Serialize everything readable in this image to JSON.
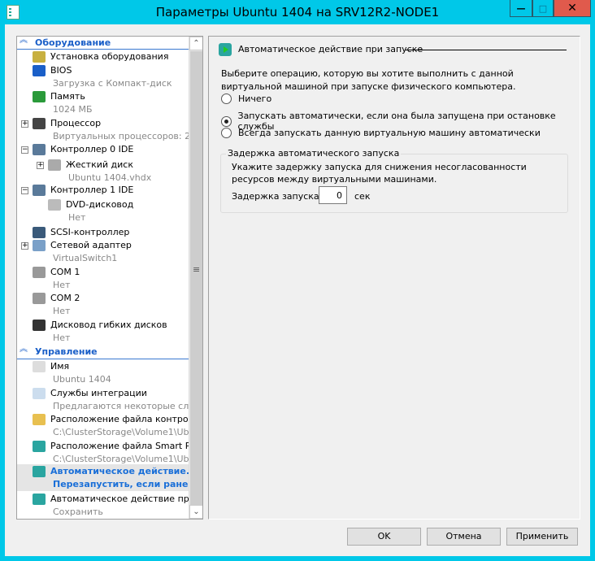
{
  "window": {
    "title": "Параметры Ubuntu 1404 на SRV12R2-NODE1",
    "minimize": "—",
    "maximize": "□",
    "close": "✕"
  },
  "tree": {
    "hardware_header": "Оборудование",
    "management_header": "Управление",
    "items": [
      {
        "label": "Установка оборудования",
        "icon": "add-hardware-icon",
        "color": "#c8b040"
      },
      {
        "label": "BIOS",
        "sub": "Загрузка с Компакт-диск",
        "icon": "bios-icon",
        "color": "#1a5fc8"
      },
      {
        "label": "Память",
        "sub": "1024 МБ",
        "icon": "memory-icon",
        "color": "#2a9a3a"
      },
      {
        "label": "Процессор",
        "sub": "Виртуальных процессоров: 2",
        "icon": "processor-icon",
        "color": "#444",
        "expander": "+"
      },
      {
        "label": "Контроллер 0 IDE",
        "icon": "ide-controller-icon",
        "color": "#5a7a9a",
        "expander": "−"
      },
      {
        "label": "Жесткий диск",
        "sub": "Ubuntu 1404.vhdx",
        "icon": "hard-disk-icon",
        "color": "#aaa",
        "expander": "+",
        "indent": true
      },
      {
        "label": "Контроллер 1 IDE",
        "icon": "ide-controller-icon",
        "color": "#5a7a9a",
        "expander": "−"
      },
      {
        "label": "DVD-дисковод",
        "sub": "Нет",
        "icon": "dvd-icon",
        "color": "#bbb",
        "indent": true
      },
      {
        "label": "SCSI-контроллер",
        "icon": "scsi-controller-icon",
        "color": "#3a5a7a"
      },
      {
        "label": "Сетевой адаптер",
        "sub": "VirtualSwitch1",
        "icon": "network-adapter-icon",
        "color": "#7aa0c8",
        "expander": "+"
      },
      {
        "label": "COM 1",
        "sub": "Нет",
        "icon": "com-port-icon",
        "color": "#999"
      },
      {
        "label": "COM 2",
        "sub": "Нет",
        "icon": "com-port-icon",
        "color": "#999"
      },
      {
        "label": "Дисковод гибких дисков",
        "sub": "Нет",
        "icon": "floppy-icon",
        "color": "#333"
      },
      {
        "label": "Имя",
        "sub": "Ubuntu 1404",
        "icon": "name-icon",
        "color": "#ddd"
      },
      {
        "label": "Службы интеграции",
        "sub": "Предлагаются некоторые сл...",
        "icon": "integration-services-icon",
        "color": "#cde"
      },
      {
        "label": "Расположение файла контрол...",
        "sub": "C:\\ClusterStorage\\Volume1\\Ub...",
        "icon": "checkpoint-folder-icon",
        "color": "#e8c050"
      },
      {
        "label": "Расположение файла Smart P...",
        "sub": "C:\\ClusterStorage\\Volume1\\Ub...",
        "icon": "smart-paging-icon",
        "color": "#2aa5a0"
      },
      {
        "label": "Автоматическое действие...",
        "sub": "Перезапустить, если ране...",
        "icon": "auto-start-icon",
        "color": "#2aa5a0",
        "selected": true
      },
      {
        "label": "Автоматическое действие пр...",
        "sub": "Сохранить",
        "icon": "auto-stop-icon",
        "color": "#2aa5a0"
      }
    ]
  },
  "panel": {
    "title": "Автоматическое действие при запуске",
    "description": "Выберите операцию, которую вы хотите выполнить с данной виртуальной машиной при запуске физического компьютера.",
    "options": [
      {
        "label": "Ничего",
        "checked": false
      },
      {
        "label": "Запускать автоматически, если она была запущена при остановке службы",
        "checked": true
      },
      {
        "label": "Всегда запускать данную виртуальную машину автоматически",
        "checked": false
      }
    ],
    "delay_group": {
      "legend": "Задержка автоматического запуска",
      "description": "Укажите задержку запуска для снижения несогласованности ресурсов между виртуальными машинами.",
      "label": "Задержка запуска:",
      "value": "0",
      "unit": "сек"
    }
  },
  "buttons": {
    "ok": "OK",
    "cancel": "Отмена",
    "apply": "Применить"
  }
}
